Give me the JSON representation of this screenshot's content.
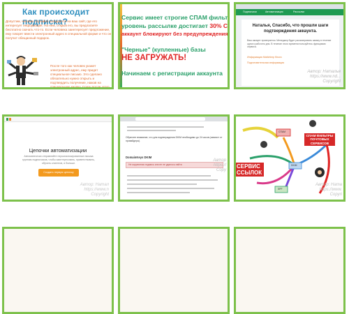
{
  "tiles": [
    {
      "id": "subscription-article",
      "title": "Как происходит подписка?",
      "body": "Допустим, человек случайно попадается на ваш сайт, где его интересует информация. На нем, открыв его, вы предлагаете бесплатно скачать что-то. Если человека заинтересует предложение, ему говорят ввести электронный адрес в специальной форме и что он получит обещанный подарок.",
      "body2": "После того как человек укажет электронный адрес, ему придет специальное письмо. Это сделано обязательно нужно открыть и подтвердить получение, нажав на специальную кнопку. Сразу после этого адрес клиента добавляется в базу подписчиков, а сам клиент получает обещанную книгу."
    },
    {
      "id": "spam-filter-slide",
      "line1": "Сервис имеет строгие СПАМ фильтры",
      "line2a": "уровень рассылке достигает",
      "line2b": "30% СПАМ",
      "line3": "аккаунт блокируют без предупреждения",
      "line4": "\"Черные\" (купленные) базы",
      "line5": "НЕ ЗАГРУЖАТЬ!",
      "line6": "Начинаем с регистрации аккаунта"
    },
    {
      "id": "confirmation-page",
      "nav": [
        "Подписчики",
        "Автоматизация",
        "Рассылки"
      ],
      "heading": "Наталья, Спасибо, что прошли шаги подтверждения аккаунта.",
      "text": "Ваш аккаунт проверяется. Менеджер будет рассматривать заявку в течение одного рабочего дня. В течение этого времени пользуйтесь функциями сервиса.",
      "link1": "Информация Mailchimp блога",
      "link2": "Подготовительная информация",
      "watermark1": "Автор: Наталья",
      "watermark2": "https://www.nd...",
      "watermark3": "Copyright"
    },
    {
      "id": "automation-chains",
      "heading": "Цепочки автоматизации",
      "desc": "Автоматически отправляйте персонализированные письма группам подписчиков, чтобы заинтересовать, приветствовать, обучить клиентов, и больше.",
      "button": "Создать первую цепочку",
      "watermark1": "Автор: Натал",
      "watermark2": "https://www.n",
      "watermark3": "Copyright"
    },
    {
      "id": "dkim-settings",
      "note": "Обратите внимание, что для подтверждения DKIM необходимо до 24 часов (зависит от провайдера).",
      "label": "DomainKeys DKIM",
      "warning": "Не корректная подпись или ее не удалось найти",
      "watermark1": "Автор",
      "watermark2": "https://",
      "watermark3": "Copy"
    },
    {
      "id": "mind-map",
      "service_label": "СЕРВИС",
      "service_sub": "ССЫЛОК",
      "spam_label": "СПАМ ФИЛЬТРЫ ПОЧТОВЫХ СЕРВИСОВ",
      "node_spam": "СПАМ",
      "node_dkim": "DKIM",
      "node_spf": "SPF",
      "watermark1": "Автор: Ната",
      "watermark2": "https://www.",
      "watermark3": "Copyri"
    }
  ],
  "colors": {
    "tile_border": "#7dc14b",
    "accent_orange": "#f39a1f",
    "accent_red": "#e02424",
    "accent_green": "#2aa06a"
  }
}
